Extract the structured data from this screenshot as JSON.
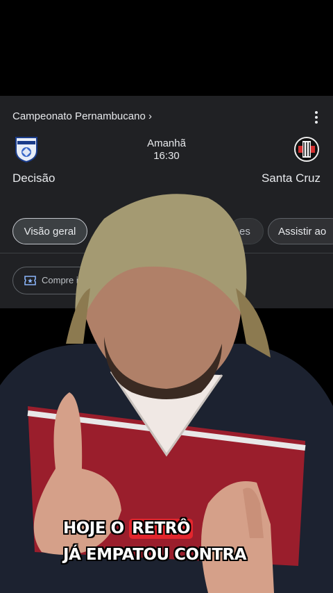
{
  "match_card": {
    "competition": "Campeonato Pernambucano ›",
    "when": {
      "day": "Amanhã",
      "time": "16:30"
    },
    "home_team": "Decisão",
    "away_team": "Santa Cruz",
    "tabs": [
      {
        "label": "Visão geral",
        "selected": true
      },
      {
        "label": "es",
        "selected": false
      },
      {
        "label": "Assistir ao",
        "selected": false
      }
    ],
    "ticket_label": "Compre ingres",
    "colors": {
      "background": "#202124",
      "accent_red": "#e3262d"
    }
  },
  "caption": {
    "line1_prefix": "HOJE O ",
    "line1_highlight": "RETRÔ",
    "line2": "JÁ EMPATOU CONTRA"
  },
  "icons": [
    "more-vert-icon",
    "decisao-crest-icon",
    "santa-cruz-crest-icon",
    "ticket-icon"
  ]
}
